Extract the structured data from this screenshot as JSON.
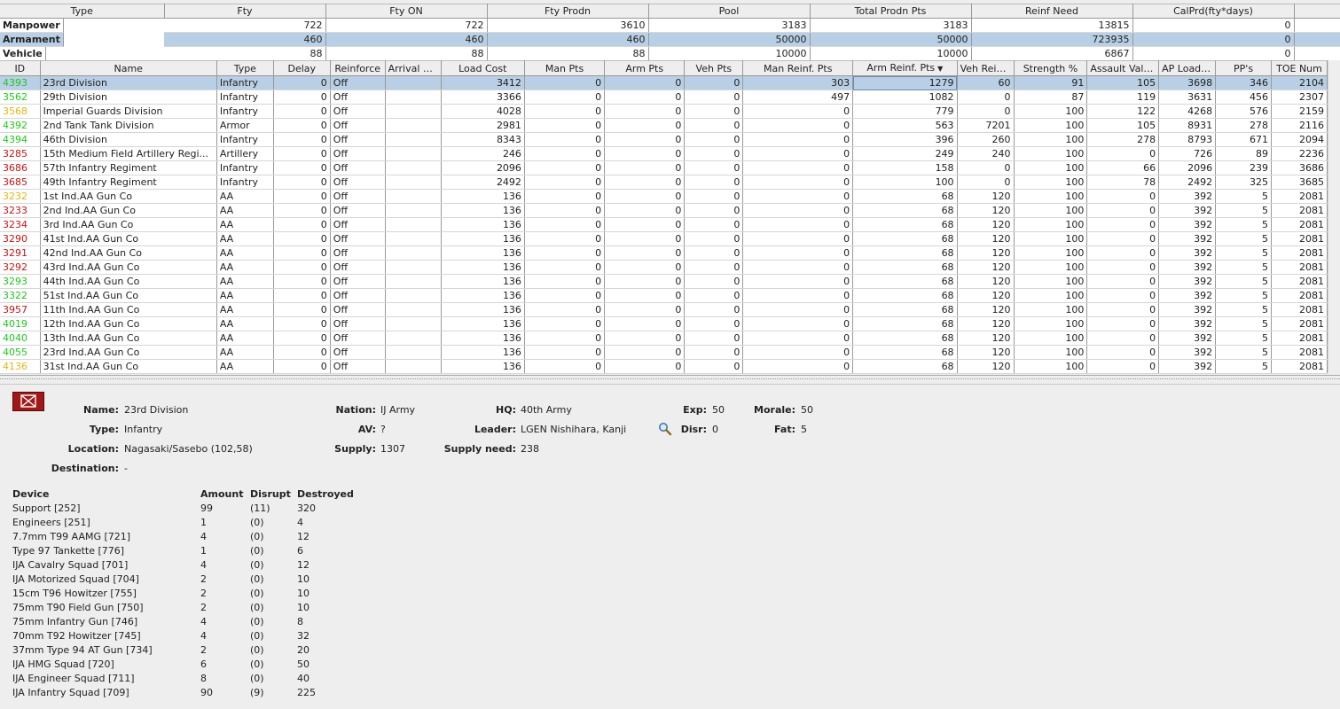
{
  "summary": {
    "headers": [
      "Type",
      "Fty",
      "Fty ON",
      "Fty Prodn",
      "Pool",
      "Total Prodn Pts",
      "Reinf Need",
      "CalPrd(fty*days)"
    ],
    "rows": [
      {
        "type": "Manpower",
        "fty": "722",
        "fty_on": "722",
        "fty_prodn": "3610",
        "pool": "3183",
        "total_prodn": "3183",
        "reinf_need": "13815",
        "calprd": "0"
      },
      {
        "type": "Armament",
        "fty": "460",
        "fty_on": "460",
        "fty_prodn": "460",
        "pool": "50000",
        "total_prodn": "50000",
        "reinf_need": "723935",
        "calprd": "0"
      },
      {
        "type": "Vehicle",
        "fty": "88",
        "fty_on": "88",
        "fty_prodn": "88",
        "pool": "10000",
        "total_prodn": "10000",
        "reinf_need": "6867",
        "calprd": "0"
      }
    ]
  },
  "units": {
    "headers": [
      "ID",
      "Name",
      "Type",
      "Delay",
      "Reinforce",
      "Arrival Port",
      "Load Cost",
      "Man Pts",
      "Arm Pts",
      "Veh Pts",
      "Man Reinf. Pts",
      "Arm Reinf. Pts",
      "Veh Rein...",
      "Strength %",
      "Assault Value",
      "AP Load ...",
      "PP's",
      "TOE Num"
    ],
    "sort_arrow": "▼",
    "rows": [
      {
        "id": "4393",
        "c": "green",
        "name": "23rd Division",
        "type": "Infantry",
        "delay": "0",
        "reinforce": "Off",
        "port": "",
        "load": "3412",
        "man": "0",
        "arm": "0",
        "veh": "0",
        "manr": "303",
        "armr": "1279",
        "vehr": "60",
        "str": "91",
        "asv": "105",
        "ap": "3698",
        "pp": "346",
        "toe": "2104"
      },
      {
        "id": "3562",
        "c": "green",
        "name": "29th Division",
        "type": "Infantry",
        "delay": "0",
        "reinforce": "Off",
        "port": "",
        "load": "3366",
        "man": "0",
        "arm": "0",
        "veh": "0",
        "manr": "497",
        "armr": "1082",
        "vehr": "0",
        "str": "87",
        "asv": "119",
        "ap": "3631",
        "pp": "456",
        "toe": "2307"
      },
      {
        "id": "3568",
        "c": "yellow",
        "name": "Imperial Guards Division",
        "type": "Infantry",
        "delay": "0",
        "reinforce": "Off",
        "port": "",
        "load": "4028",
        "man": "0",
        "arm": "0",
        "veh": "0",
        "manr": "0",
        "armr": "779",
        "vehr": "0",
        "str": "100",
        "asv": "122",
        "ap": "4268",
        "pp": "576",
        "toe": "2159"
      },
      {
        "id": "4392",
        "c": "green",
        "name": "2nd Tank Tank Division",
        "type": "Armor",
        "delay": "0",
        "reinforce": "Off",
        "port": "",
        "load": "2981",
        "man": "0",
        "arm": "0",
        "veh": "0",
        "manr": "0",
        "armr": "563",
        "vehr": "7201",
        "str": "100",
        "asv": "105",
        "ap": "8931",
        "pp": "278",
        "toe": "2116"
      },
      {
        "id": "4394",
        "c": "green",
        "name": "46th Division",
        "type": "Infantry",
        "delay": "0",
        "reinforce": "Off",
        "port": "",
        "load": "8343",
        "man": "0",
        "arm": "0",
        "veh": "0",
        "manr": "0",
        "armr": "396",
        "vehr": "260",
        "str": "100",
        "asv": "278",
        "ap": "8793",
        "pp": "671",
        "toe": "2094"
      },
      {
        "id": "3285",
        "c": "red",
        "name": "15th Medium Field Artillery Regi...",
        "type": "Artillery",
        "delay": "0",
        "reinforce": "Off",
        "port": "",
        "load": "246",
        "man": "0",
        "arm": "0",
        "veh": "0",
        "manr": "0",
        "armr": "249",
        "vehr": "240",
        "str": "100",
        "asv": "0",
        "ap": "726",
        "pp": "89",
        "toe": "2236"
      },
      {
        "id": "3686",
        "c": "red",
        "name": "57th Infantry Regiment",
        "type": "Infantry",
        "delay": "0",
        "reinforce": "Off",
        "port": "",
        "load": "2096",
        "man": "0",
        "arm": "0",
        "veh": "0",
        "manr": "0",
        "armr": "158",
        "vehr": "0",
        "str": "100",
        "asv": "66",
        "ap": "2096",
        "pp": "239",
        "toe": "3686"
      },
      {
        "id": "3685",
        "c": "red",
        "name": "49th Infantry Regiment",
        "type": "Infantry",
        "delay": "0",
        "reinforce": "Off",
        "port": "",
        "load": "2492",
        "man": "0",
        "arm": "0",
        "veh": "0",
        "manr": "0",
        "armr": "100",
        "vehr": "0",
        "str": "100",
        "asv": "78",
        "ap": "2492",
        "pp": "325",
        "toe": "3685"
      },
      {
        "id": "3232",
        "c": "yellow",
        "name": "1st Ind.AA Gun Co",
        "type": "AA",
        "delay": "0",
        "reinforce": "Off",
        "port": "",
        "load": "136",
        "man": "0",
        "arm": "0",
        "veh": "0",
        "manr": "0",
        "armr": "68",
        "vehr": "120",
        "str": "100",
        "asv": "0",
        "ap": "392",
        "pp": "5",
        "toe": "2081"
      },
      {
        "id": "3233",
        "c": "red",
        "name": "2nd Ind.AA Gun Co",
        "type": "AA",
        "delay": "0",
        "reinforce": "Off",
        "port": "",
        "load": "136",
        "man": "0",
        "arm": "0",
        "veh": "0",
        "manr": "0",
        "armr": "68",
        "vehr": "120",
        "str": "100",
        "asv": "0",
        "ap": "392",
        "pp": "5",
        "toe": "2081"
      },
      {
        "id": "3234",
        "c": "red",
        "name": "3rd Ind.AA Gun Co",
        "type": "AA",
        "delay": "0",
        "reinforce": "Off",
        "port": "",
        "load": "136",
        "man": "0",
        "arm": "0",
        "veh": "0",
        "manr": "0",
        "armr": "68",
        "vehr": "120",
        "str": "100",
        "asv": "0",
        "ap": "392",
        "pp": "5",
        "toe": "2081"
      },
      {
        "id": "3290",
        "c": "red",
        "name": "41st Ind.AA Gun Co",
        "type": "AA",
        "delay": "0",
        "reinforce": "Off",
        "port": "",
        "load": "136",
        "man": "0",
        "arm": "0",
        "veh": "0",
        "manr": "0",
        "armr": "68",
        "vehr": "120",
        "str": "100",
        "asv": "0",
        "ap": "392",
        "pp": "5",
        "toe": "2081"
      },
      {
        "id": "3291",
        "c": "red",
        "name": "42nd Ind.AA Gun Co",
        "type": "AA",
        "delay": "0",
        "reinforce": "Off",
        "port": "",
        "load": "136",
        "man": "0",
        "arm": "0",
        "veh": "0",
        "manr": "0",
        "armr": "68",
        "vehr": "120",
        "str": "100",
        "asv": "0",
        "ap": "392",
        "pp": "5",
        "toe": "2081"
      },
      {
        "id": "3292",
        "c": "red",
        "name": "43rd Ind.AA Gun Co",
        "type": "AA",
        "delay": "0",
        "reinforce": "Off",
        "port": "",
        "load": "136",
        "man": "0",
        "arm": "0",
        "veh": "0",
        "manr": "0",
        "armr": "68",
        "vehr": "120",
        "str": "100",
        "asv": "0",
        "ap": "392",
        "pp": "5",
        "toe": "2081"
      },
      {
        "id": "3293",
        "c": "green",
        "name": "44th Ind.AA Gun Co",
        "type": "AA",
        "delay": "0",
        "reinforce": "Off",
        "port": "",
        "load": "136",
        "man": "0",
        "arm": "0",
        "veh": "0",
        "manr": "0",
        "armr": "68",
        "vehr": "120",
        "str": "100",
        "asv": "0",
        "ap": "392",
        "pp": "5",
        "toe": "2081"
      },
      {
        "id": "3322",
        "c": "green",
        "name": "51st Ind.AA Gun Co",
        "type": "AA",
        "delay": "0",
        "reinforce": "Off",
        "port": "",
        "load": "136",
        "man": "0",
        "arm": "0",
        "veh": "0",
        "manr": "0",
        "armr": "68",
        "vehr": "120",
        "str": "100",
        "asv": "0",
        "ap": "392",
        "pp": "5",
        "toe": "2081"
      },
      {
        "id": "3957",
        "c": "red",
        "name": "11th Ind.AA Gun Co",
        "type": "AA",
        "delay": "0",
        "reinforce": "Off",
        "port": "",
        "load": "136",
        "man": "0",
        "arm": "0",
        "veh": "0",
        "manr": "0",
        "armr": "68",
        "vehr": "120",
        "str": "100",
        "asv": "0",
        "ap": "392",
        "pp": "5",
        "toe": "2081"
      },
      {
        "id": "4019",
        "c": "green",
        "name": "12th Ind.AA Gun Co",
        "type": "AA",
        "delay": "0",
        "reinforce": "Off",
        "port": "",
        "load": "136",
        "man": "0",
        "arm": "0",
        "veh": "0",
        "manr": "0",
        "armr": "68",
        "vehr": "120",
        "str": "100",
        "asv": "0",
        "ap": "392",
        "pp": "5",
        "toe": "2081"
      },
      {
        "id": "4040",
        "c": "green",
        "name": "13th Ind.AA Gun Co",
        "type": "AA",
        "delay": "0",
        "reinforce": "Off",
        "port": "",
        "load": "136",
        "man": "0",
        "arm": "0",
        "veh": "0",
        "manr": "0",
        "armr": "68",
        "vehr": "120",
        "str": "100",
        "asv": "0",
        "ap": "392",
        "pp": "5",
        "toe": "2081"
      },
      {
        "id": "4055",
        "c": "green",
        "name": "23rd Ind.AA Gun Co",
        "type": "AA",
        "delay": "0",
        "reinforce": "Off",
        "port": "",
        "load": "136",
        "man": "0",
        "arm": "0",
        "veh": "0",
        "manr": "0",
        "armr": "68",
        "vehr": "120",
        "str": "100",
        "asv": "0",
        "ap": "392",
        "pp": "5",
        "toe": "2081"
      },
      {
        "id": "4136",
        "c": "yellow",
        "name": "31st Ind.AA Gun Co",
        "type": "AA",
        "delay": "0",
        "reinforce": "Off",
        "port": "",
        "load": "136",
        "man": "0",
        "arm": "0",
        "veh": "0",
        "manr": "0",
        "armr": "68",
        "vehr": "120",
        "str": "100",
        "asv": "0",
        "ap": "392",
        "pp": "5",
        "toe": "2081"
      }
    ]
  },
  "detail": {
    "labels": {
      "name": "Name:",
      "type": "Type:",
      "location": "Location:",
      "destination": "Destination:",
      "nation": "Nation:",
      "av": "AV:",
      "supply": "Supply:",
      "hq": "HQ:",
      "leader": "Leader:",
      "supply_need": "Supply need:",
      "exp": "Exp:",
      "disr": "Disr:",
      "morale": "Morale:",
      "fat": "Fat:"
    },
    "name": "23rd Division",
    "type": "Infantry",
    "location": "Nagasaki/Sasebo (102,58)",
    "destination": "-",
    "nation": "IJ Army",
    "av": "?",
    "supply": "1307",
    "hq": "40th Army",
    "leader": "LGEN Nishihara, Kanji",
    "supply_need": "238",
    "exp": "50",
    "disr": "0",
    "morale": "50",
    "fat": "5",
    "device_headers": {
      "device": "Device",
      "amount": "Amount",
      "disrupt": "Disrupt",
      "destroyed": "Destroyed"
    },
    "devices": [
      {
        "device": "Support [252]",
        "amount": "99",
        "disrupt": "(11)",
        "destroyed": "320"
      },
      {
        "device": "Engineers [251]",
        "amount": "1",
        "disrupt": "(0)",
        "destroyed": "4"
      },
      {
        "device": "7.7mm T99 AAMG [721]",
        "amount": "4",
        "disrupt": "(0)",
        "destroyed": "12"
      },
      {
        "device": "Type 97 Tankette [776]",
        "amount": "1",
        "disrupt": "(0)",
        "destroyed": "6"
      },
      {
        "device": "IJA Cavalry Squad [701]",
        "amount": "4",
        "disrupt": "(0)",
        "destroyed": "12"
      },
      {
        "device": "IJA Motorized Squad [704]",
        "amount": "2",
        "disrupt": "(0)",
        "destroyed": "10"
      },
      {
        "device": "15cm T96 Howitzer [755]",
        "amount": "2",
        "disrupt": "(0)",
        "destroyed": "10"
      },
      {
        "device": "75mm T90 Field Gun [750]",
        "amount": "2",
        "disrupt": "(0)",
        "destroyed": "10"
      },
      {
        "device": "75mm Infantry Gun [746]",
        "amount": "4",
        "disrupt": "(0)",
        "destroyed": "8"
      },
      {
        "device": "70mm T92 Howitzer [745]",
        "amount": "4",
        "disrupt": "(0)",
        "destroyed": "32"
      },
      {
        "device": "37mm Type 94 AT Gun [734]",
        "amount": "2",
        "disrupt": "(0)",
        "destroyed": "20"
      },
      {
        "device": "IJA HMG Squad [720]",
        "amount": "6",
        "disrupt": "(0)",
        "destroyed": "50"
      },
      {
        "device": "IJA Engineer Squad [711]",
        "amount": "8",
        "disrupt": "(0)",
        "destroyed": "40"
      },
      {
        "device": "IJA Infantry Squad [709]",
        "amount": "90",
        "disrupt": "(9)",
        "destroyed": "225"
      }
    ]
  },
  "icons": {
    "mail": "envelope-icon",
    "search": "magnifier-icon"
  },
  "colors": {
    "selection": "#b8cfe5",
    "id_green": "#1ec81e",
    "id_red": "#c81414",
    "id_yellow": "#e6b414",
    "mail_bg": "#a01818"
  }
}
